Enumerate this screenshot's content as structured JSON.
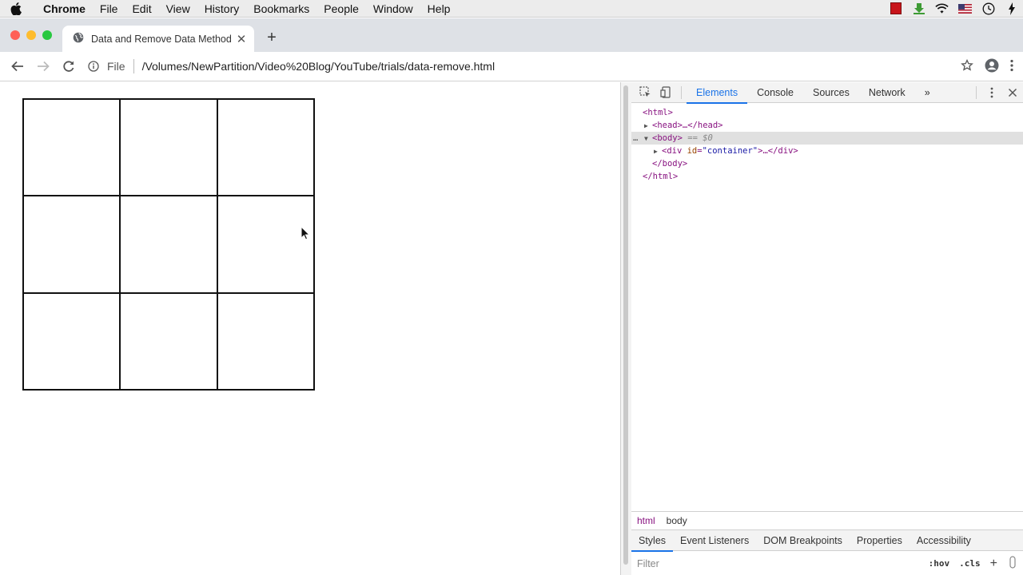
{
  "menubar": {
    "app": "Chrome",
    "items": [
      "File",
      "Edit",
      "View",
      "History",
      "Bookmarks",
      "People",
      "Window",
      "Help"
    ]
  },
  "tab": {
    "title": "Data and Remove Data Method",
    "new_tab": "+"
  },
  "toolbar": {
    "scheme_label": "File",
    "url": "/Volumes/NewPartition/Video%20Blog/YouTube/trials/data-remove.html"
  },
  "devtools": {
    "tabs": [
      "Elements",
      "Console",
      "Sources",
      "Network"
    ],
    "more": "»",
    "dom": {
      "html_open": "<html>",
      "head": "<head>…</head>",
      "body_open": "<body>",
      "body_marker": " == $0",
      "div_tag_start": "<div ",
      "div_attr": "id",
      "div_val": "\"container\"",
      "div_rest": ">…</div>",
      "body_close": "</body>",
      "html_close": "</html>"
    },
    "breadcrumbs": [
      "html",
      "body"
    ],
    "subtabs": [
      "Styles",
      "Event Listeners",
      "DOM Breakpoints",
      "Properties",
      "Accessibility"
    ],
    "filter_placeholder": "Filter",
    "hov": ":hov",
    "cls": ".cls"
  },
  "colors": {
    "tab_active": "#1a73e8",
    "traffic_close": "#fe5f57",
    "traffic_min": "#febc2e",
    "traffic_max": "#28c840"
  }
}
